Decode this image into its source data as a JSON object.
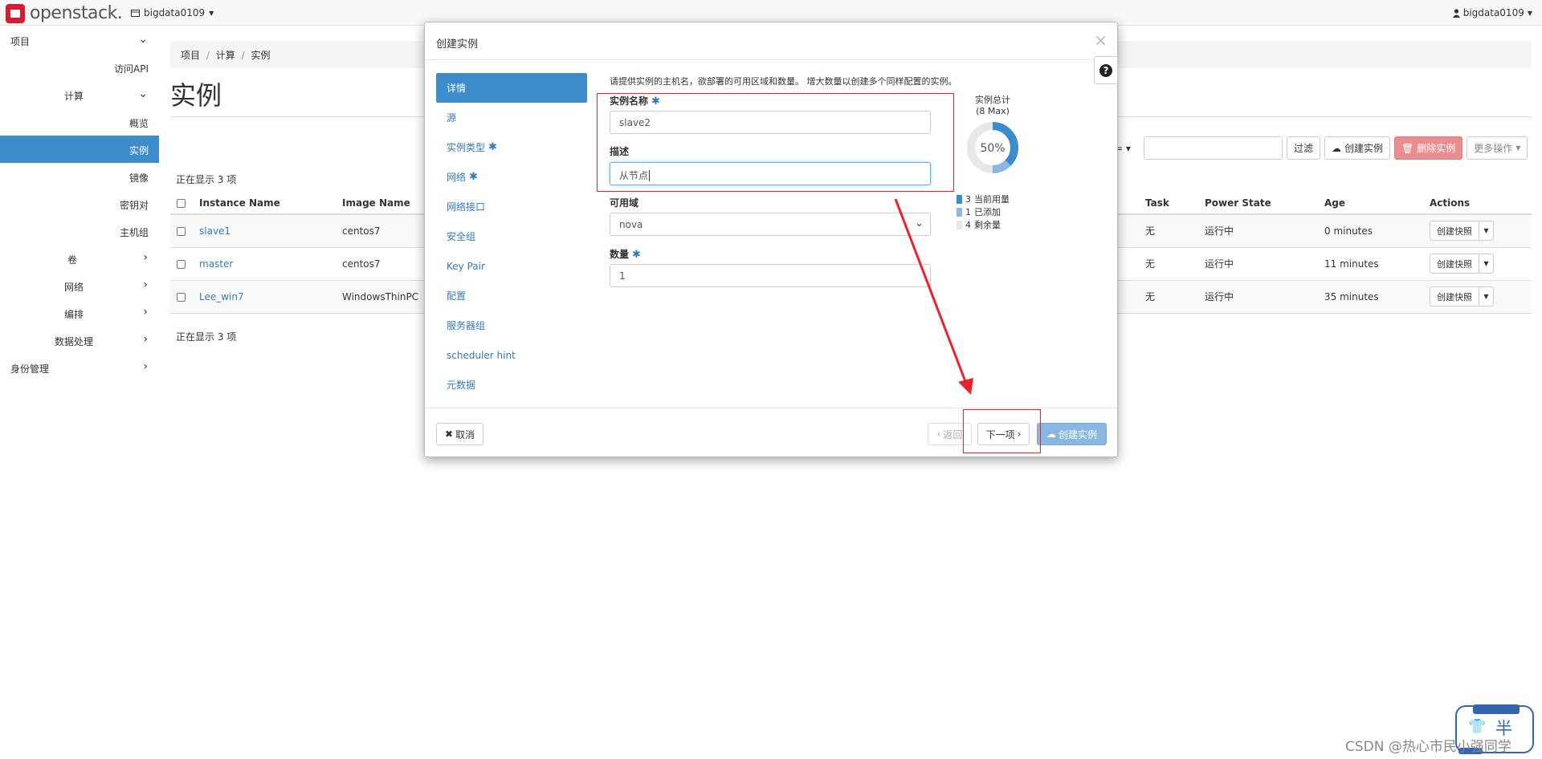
{
  "topbar": {
    "brand": "openstack.",
    "project": "bigdata0109",
    "user": "bigdata0109"
  },
  "sidebar": {
    "items": [
      {
        "label": "项目"
      },
      {
        "label": "访问API"
      },
      {
        "label": "计算"
      },
      {
        "label": "概览"
      },
      {
        "label": "实例"
      },
      {
        "label": "镜像"
      },
      {
        "label": "密钥对"
      },
      {
        "label": "主机组"
      },
      {
        "label": "卷"
      },
      {
        "label": "网络"
      },
      {
        "label": "编排"
      },
      {
        "label": "数据处理"
      },
      {
        "label": "身份管理"
      }
    ]
  },
  "breadcrumb": [
    "项目",
    "计算",
    "实例"
  ],
  "page_title": "实例",
  "toolbar": {
    "filter_label": "过滤",
    "create_label": "创建实例",
    "delete_label": "删除实例",
    "more_label": "更多操作"
  },
  "table": {
    "count_text": "正在显示 3 项",
    "headers": [
      "Instance Name",
      "Image Name",
      "Task",
      "Power State",
      "Age",
      "Actions"
    ],
    "rows": [
      {
        "name": "slave1",
        "image": "centos7",
        "task": "无",
        "power": "运行中",
        "age": "0 minutes",
        "action": "创建快照"
      },
      {
        "name": "master",
        "image": "centos7",
        "task": "无",
        "power": "运行中",
        "age": "11 minutes",
        "action": "创建快照"
      },
      {
        "name": "Lee_win7",
        "image": "WindowsThinPC",
        "task": "无",
        "power": "运行中",
        "age": "35 minutes",
        "action": "创建快照"
      }
    ]
  },
  "modal": {
    "title": "创建实例",
    "close": "×",
    "steps": [
      {
        "label": "详情"
      },
      {
        "label": "源"
      },
      {
        "label": "实例类型",
        "req": "✱"
      },
      {
        "label": "网络",
        "req": "✱"
      },
      {
        "label": "网络接口"
      },
      {
        "label": "安全组"
      },
      {
        "label": "Key Pair"
      },
      {
        "label": "配置"
      },
      {
        "label": "服务器组"
      },
      {
        "label": "scheduler hint"
      },
      {
        "label": "元数据"
      }
    ],
    "intro": "请提供实例的主机名，欲部署的可用区域和数量。 增大数量以创建多个同样配置的实例。",
    "fields": {
      "name_label": "实例名称",
      "name_value": "slave2",
      "desc_label": "描述",
      "desc_value": "从节点",
      "zone_label": "可用域",
      "zone_value": "nova",
      "count_label": "数量",
      "count_value": "1",
      "req_mark": "✱"
    },
    "quota": {
      "title": "实例总计",
      "max": "(8 Max)",
      "percent_label": "50%",
      "percent": 50,
      "legend": [
        {
          "count": "3",
          "label": "当前用量",
          "color": "#3d8dcd"
        },
        {
          "count": "1",
          "label": "已添加",
          "color": "#8bb8e0"
        },
        {
          "count": "4",
          "label": "剩余量",
          "color": "#e8e8e8"
        }
      ]
    },
    "footer": {
      "cancel": "取消",
      "back": "返回",
      "next": "下一项",
      "create": "创建实例"
    }
  },
  "widget_text": "半",
  "watermark": "CSDN @热心市民小强同学"
}
